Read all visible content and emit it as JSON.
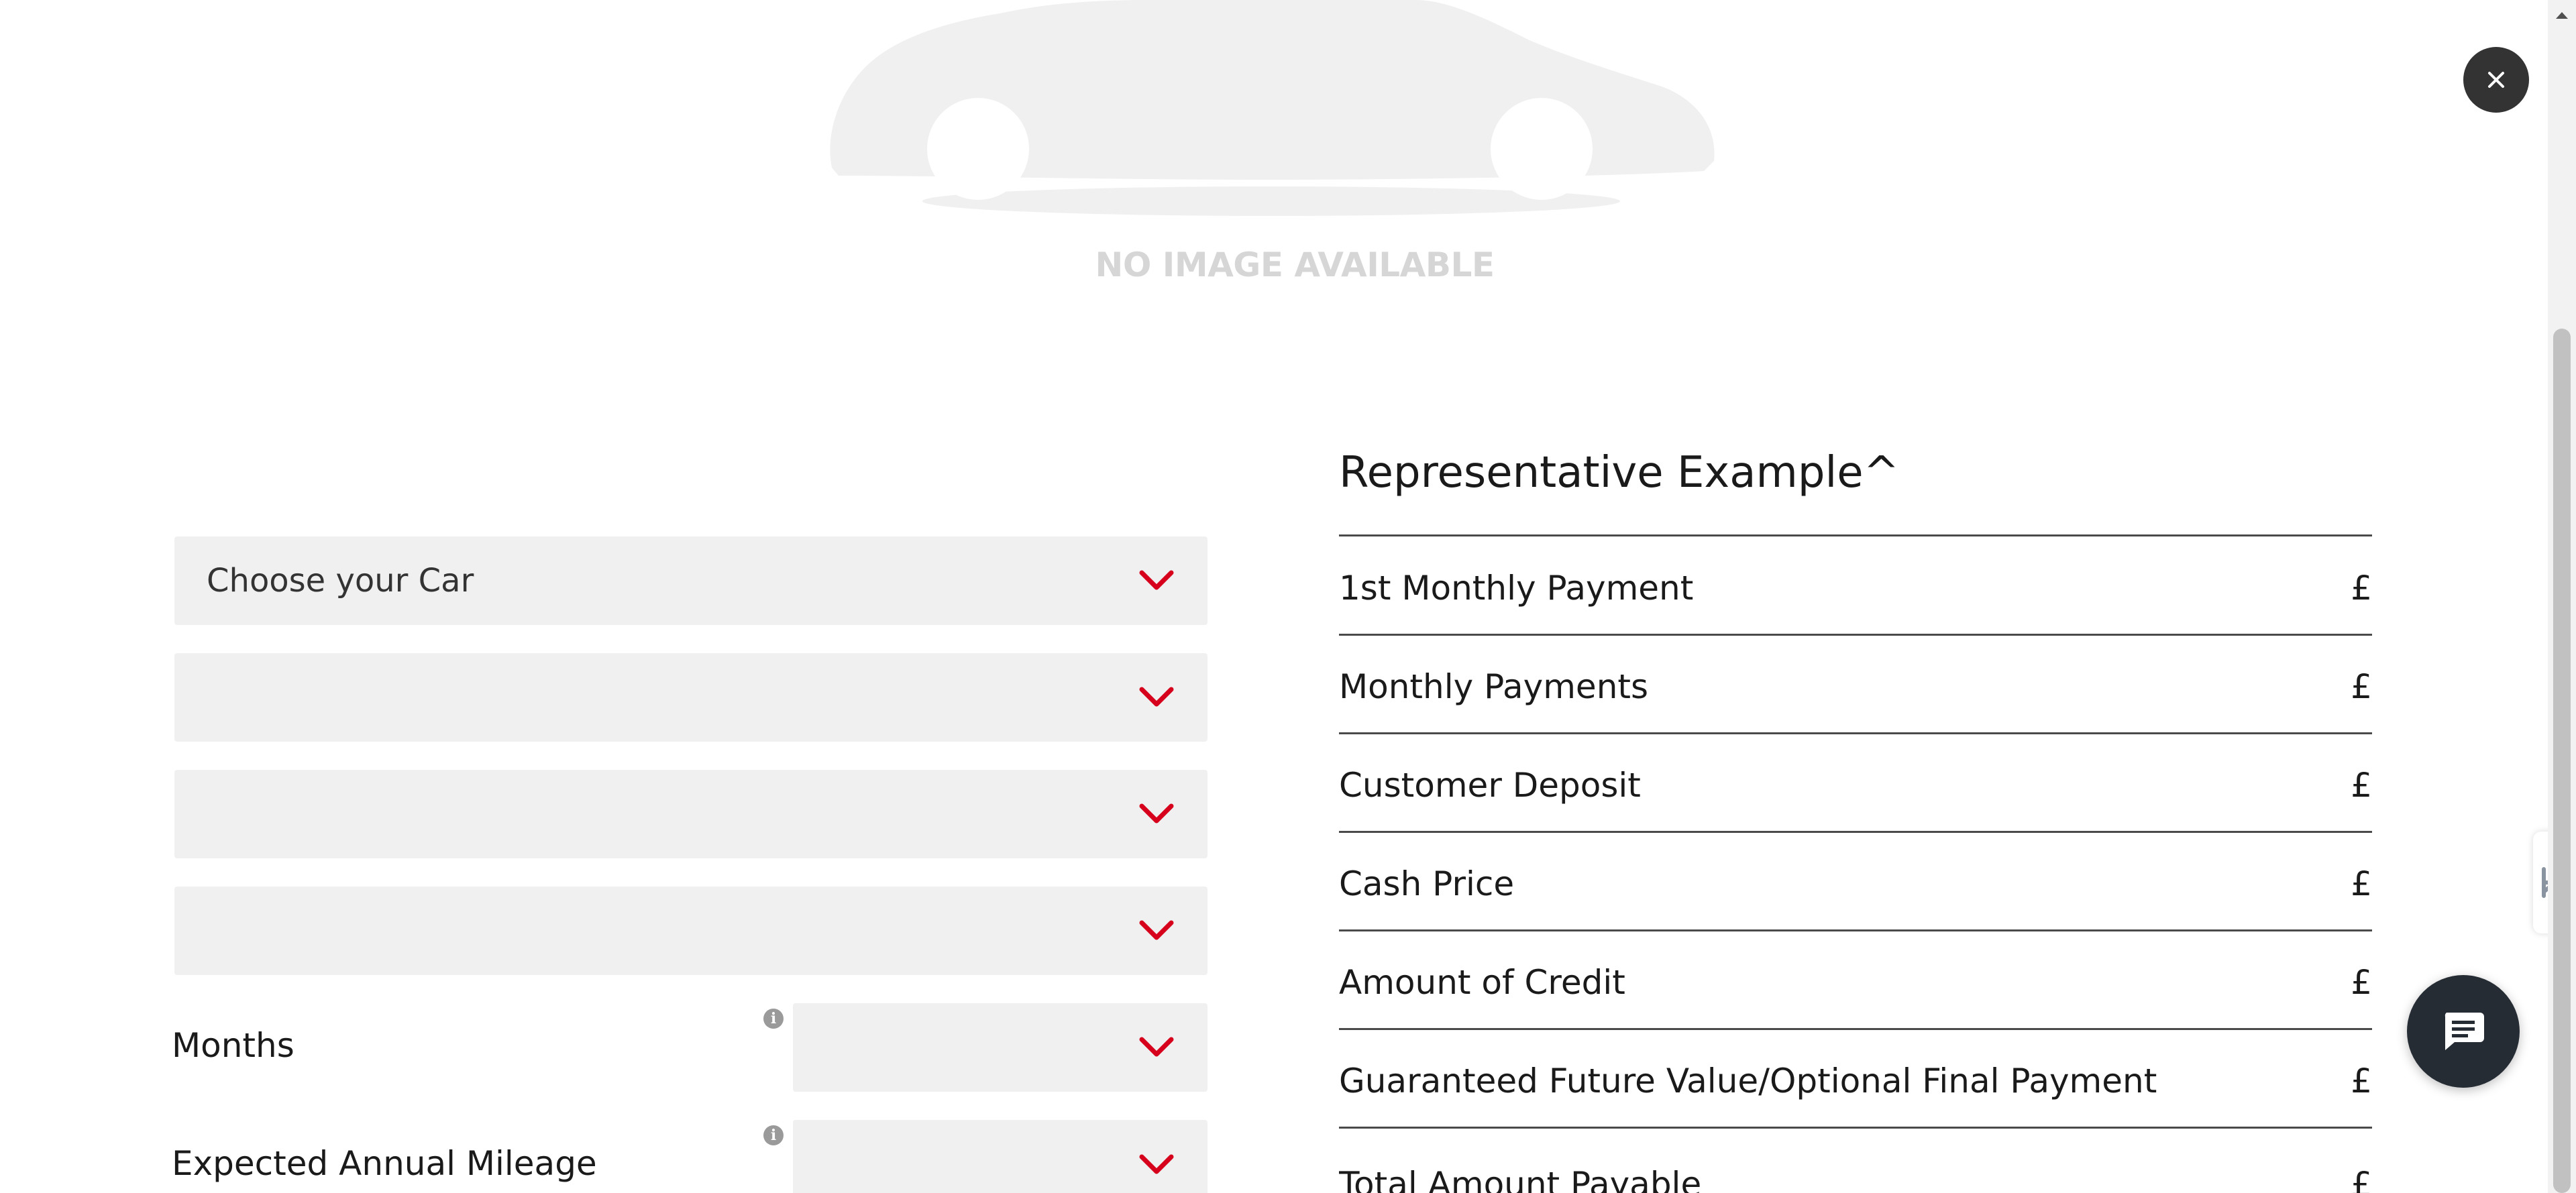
{
  "vehicle_image": {
    "placeholder_text": "NO IMAGE AVAILABLE"
  },
  "form": {
    "car_select": {
      "value": "Choose your Car",
      "icon": "chevron-down-icon"
    },
    "select_2": {
      "value": ""
    },
    "select_3": {
      "value": ""
    },
    "select_4": {
      "value": ""
    },
    "months": {
      "label": "Months",
      "value": ""
    },
    "mileage": {
      "label": "Expected Annual Mileage",
      "value": ""
    },
    "accent_color": "#d6001c"
  },
  "representative_example": {
    "title": "Representative Example^",
    "rows": [
      {
        "label": "1st Monthly Payment",
        "value": "£"
      },
      {
        "label": "Monthly Payments",
        "value": "£"
      },
      {
        "label": "Customer Deposit",
        "value": "£"
      },
      {
        "label": "Cash Price",
        "value": "£"
      },
      {
        "label": "Amount of Credit",
        "value": "£"
      },
      {
        "label": "Guaranteed Future Value/Optional Final Payment",
        "value": "£"
      },
      {
        "label": "Total Amount Payable",
        "value": "£"
      }
    ]
  },
  "widgets": {
    "close_icon": "close-icon",
    "chat_icon": "chat-bubble-icon",
    "side_tab_icon": "feedback-icon"
  }
}
